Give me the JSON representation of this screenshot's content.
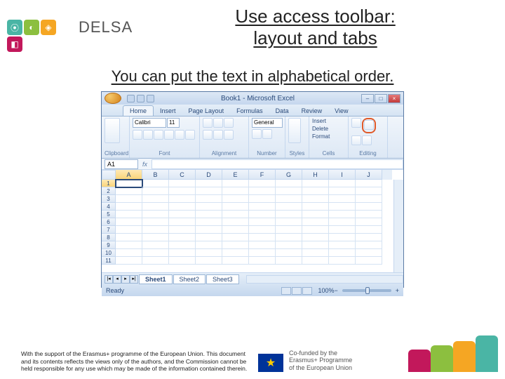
{
  "header": {
    "logo_text": "DELSA",
    "title_line1": "Use access toolbar:",
    "title_line2": "layout and tabs"
  },
  "subtitle": "You can put the text in alphabetical order.",
  "excel": {
    "titlebar": "Book1 - Microsoft Excel",
    "tabs": [
      "Home",
      "Insert",
      "Page Layout",
      "Formulas",
      "Data",
      "Review",
      "View"
    ],
    "active_tab": 0,
    "groups": {
      "clipboard": "Clipboard",
      "font": "Font",
      "alignment": "Alignment",
      "number": "Number",
      "styles": "Styles",
      "cells": "Cells",
      "editing": "Editing"
    },
    "font_name": "Calibri",
    "font_size": "11",
    "number_format": "General",
    "cells_cmds": [
      "Insert",
      "Delete",
      "Format"
    ],
    "name_box": "A1",
    "formula_fx": "fx",
    "columns": [
      "A",
      "B",
      "C",
      "D",
      "E",
      "F",
      "G",
      "H",
      "I",
      "J"
    ],
    "rows": [
      "1",
      "2",
      "3",
      "4",
      "5",
      "6",
      "7",
      "8",
      "9",
      "10",
      "11"
    ],
    "active_cell": {
      "row": 0,
      "col": 0
    },
    "sheet_tabs": [
      "Sheet1",
      "Sheet2",
      "Sheet3"
    ],
    "active_sheet": 0,
    "status": "Ready",
    "zoom": "100%"
  },
  "footer": {
    "disclaimer": "With the support of the Erasmus+ programme of the European Union. This document and its contents reflects the views only of the authors, and the Commission cannot be held responsible for any use which may be made of the information contained therein.",
    "cofund_line1": "Co-funded by the",
    "cofund_line2": "Erasmus+ Programme",
    "cofund_line3": "of the European Union"
  }
}
